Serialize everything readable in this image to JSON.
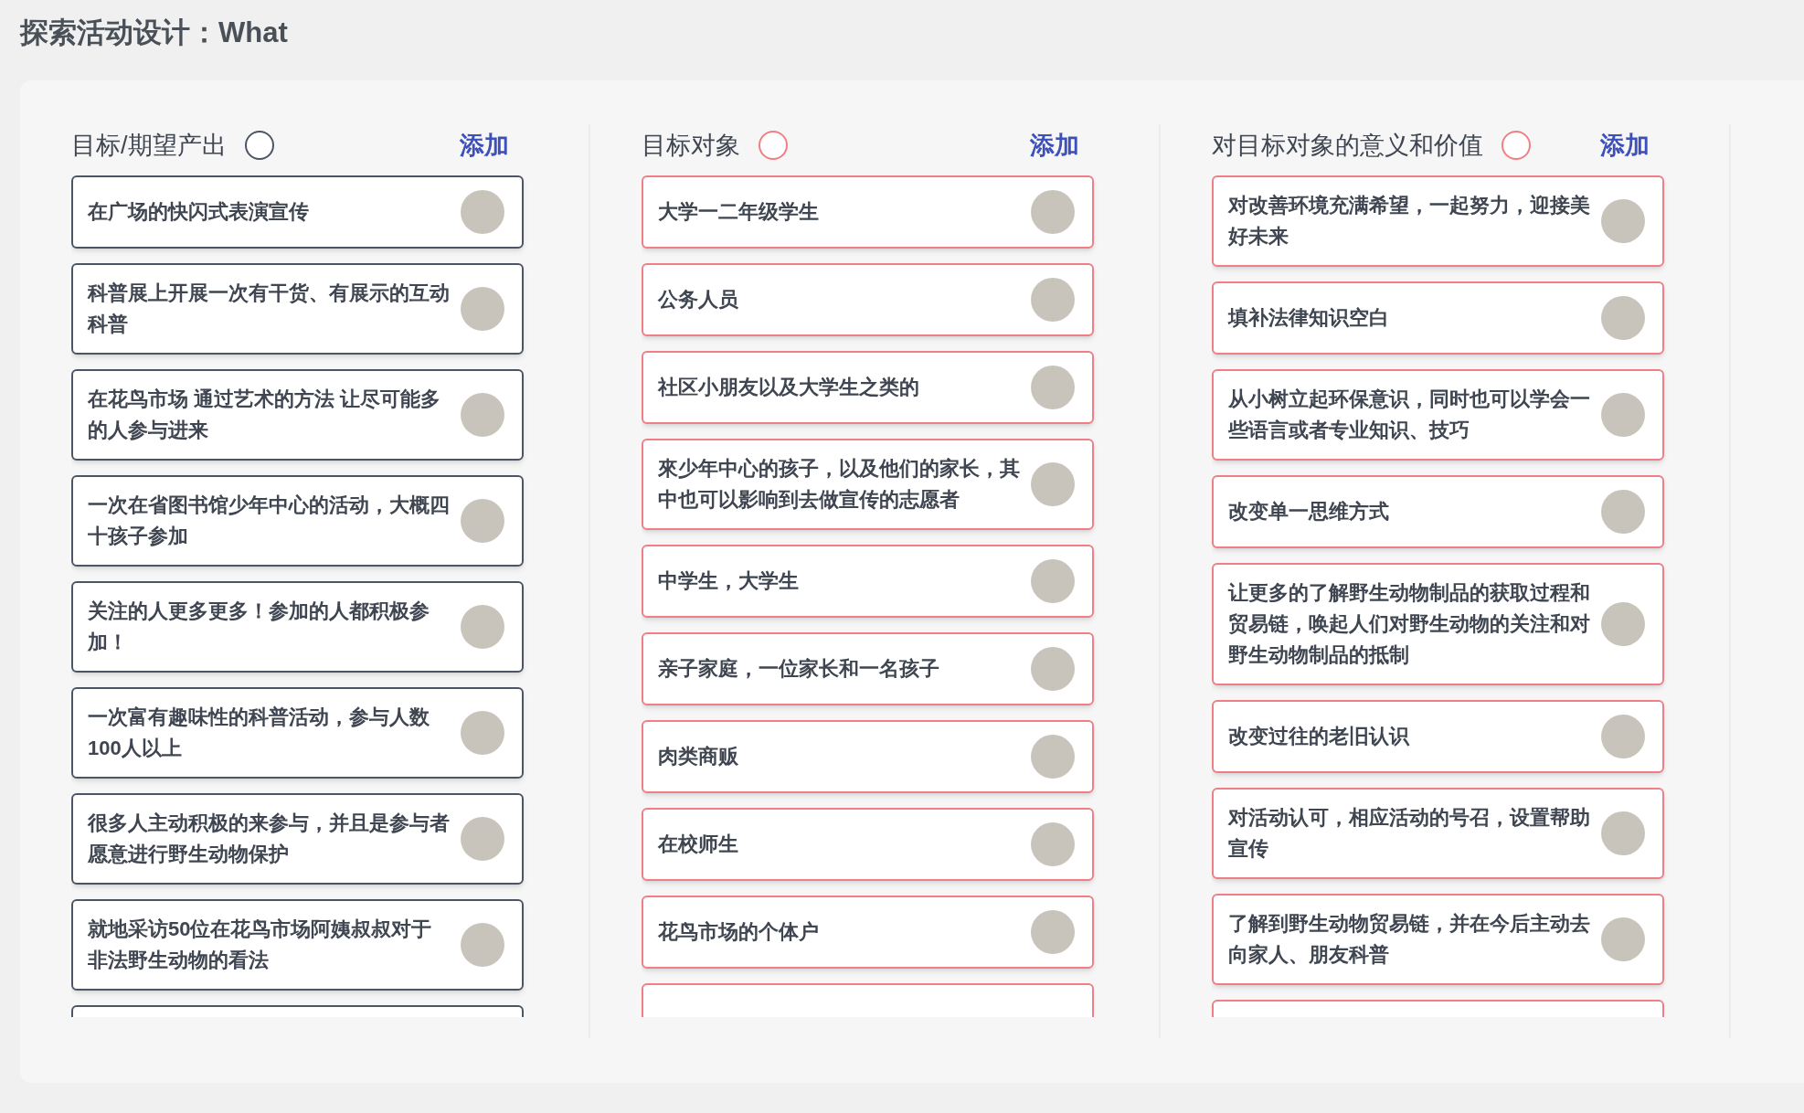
{
  "page_title": "探索活动设计：What",
  "columns": [
    {
      "title": "目标/期望产出",
      "color": "#4b5563",
      "add_label": "添加",
      "more_below": true,
      "cards": [
        {
          "text": "在广场的快闪式表演宣传"
        },
        {
          "text": "科普展上开展一次有干货、有展示的互动科普"
        },
        {
          "text": "在花鸟市场 通过艺术的方法 让尽可能多的人参与进来"
        },
        {
          "text": "一次在省图书馆少年中心的活动，大概四十孩子参加"
        },
        {
          "text": "关注的人更多更多！参加的人都积极参加！"
        },
        {
          "text": "一次富有趣味性的科普活动，参与人数100人以上"
        },
        {
          "text": "很多人主动积极的来参与，并且是参与者愿意进行野生动物保护"
        },
        {
          "text": "就地采访50位在花鸟市场阿姨叔叔对于非法野生动物的看法"
        }
      ]
    },
    {
      "title": "目标对象",
      "color": "#ef7f85",
      "add_label": "添加",
      "more_below": true,
      "cards": [
        {
          "text": "大学一二年级学生"
        },
        {
          "text": "公务人员"
        },
        {
          "text": "社区小朋友以及大学生之类的"
        },
        {
          "text": "來少年中心的孩子，以及他们的家长，其中也可以影响到去做宣传的志愿者"
        },
        {
          "text": "中学生，大学生"
        },
        {
          "text": "亲子家庭，一位家长和一名孩子"
        },
        {
          "text": "肉类商贩"
        },
        {
          "text": "在校师生"
        },
        {
          "text": "花鸟市场的个体户"
        }
      ]
    },
    {
      "title": "对目标对象的意义和价值",
      "color": "#ef7f85",
      "add_label": "添加",
      "more_below": true,
      "cards": [
        {
          "text": "对改善环境充满希望，一起努力，迎接美好未来"
        },
        {
          "text": "填补法律知识空白"
        },
        {
          "text": "从小树立起环保意识，同时也可以学会一些语言或者专业知识、技巧"
        },
        {
          "text": "改变单一思维方式"
        },
        {
          "text": "让更多的了解野生动物制品的获取过程和贸易链，唤起人们对野生动物的关注和对野生动物制品的抵制"
        },
        {
          "text": "改变过往的老旧认识"
        },
        {
          "text": "对活动认可，相应活动的号召，设置帮助宣传"
        },
        {
          "text": "了解到野生动物贸易链，并在今后主动去向家人、朋友科普"
        }
      ]
    }
  ]
}
